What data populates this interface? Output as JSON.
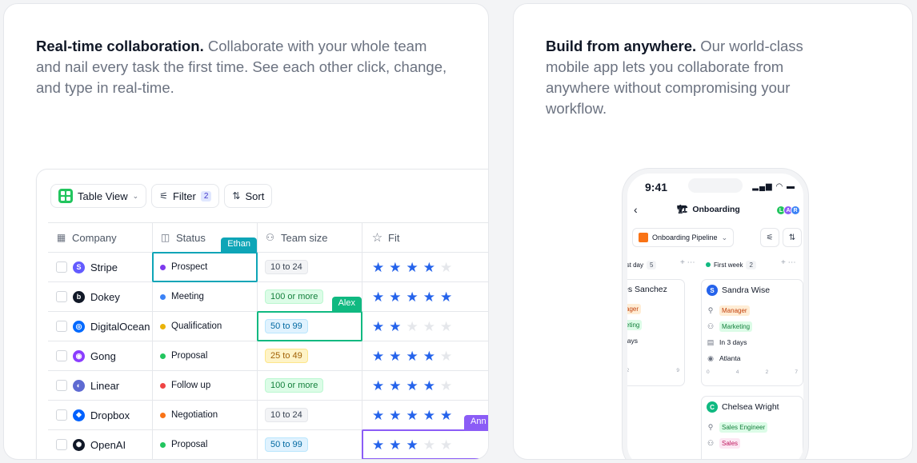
{
  "left_card": {
    "headline": "Real-time collaboration.",
    "body": " Collaborate with your whole team and nail every task the first time. See each other click, change, and type in real-time."
  },
  "right_card": {
    "headline": "Build from anywhere.",
    "body": " Our world-class mobile app lets you collaborate from anywhere without compromising your workflow."
  },
  "toolbar": {
    "table_view_label": "Table View",
    "filter_label": "Filter",
    "filter_count": "2",
    "sort_label": "Sort"
  },
  "columns": {
    "company": "Company",
    "status": "Status",
    "team_size": "Team size",
    "fit": "Fit"
  },
  "rows": [
    {
      "company": "Stripe",
      "logo_color": "#635bff",
      "logo_glyph": "S",
      "status": "Prospect",
      "status_color": "#7c3aed",
      "team": "10 to 24",
      "team_style": "gray",
      "fit": 4
    },
    {
      "company": "Dokey",
      "logo_color": "#111827",
      "logo_glyph": "b",
      "status": "Meeting",
      "status_color": "#3b82f6",
      "team": "100 or more",
      "team_style": "green",
      "fit": 5
    },
    {
      "company": "DigitalOcean",
      "logo_color": "#0069ff",
      "logo_glyph": "◎",
      "status": "Qualification",
      "status_color": "#eab308",
      "team": "50 to 99",
      "team_style": "blue",
      "fit": 2
    },
    {
      "company": "Gong",
      "logo_color": "#8b3dff",
      "logo_glyph": "◉",
      "status": "Proposal",
      "status_color": "#22c55e",
      "team": "25 to 49",
      "team_style": "yellow",
      "fit": 4
    },
    {
      "company": "Linear",
      "logo_color": "#5e6ad2",
      "logo_glyph": "◐",
      "status": "Follow up",
      "status_color": "#ef4444",
      "team": "100 or more",
      "team_style": "green",
      "fit": 4
    },
    {
      "company": "Dropbox",
      "logo_color": "#0061fe",
      "logo_glyph": "❖",
      "status": "Negotiation",
      "status_color": "#f97316",
      "team": "10 to 24",
      "team_style": "gray",
      "fit": 5
    },
    {
      "company": "OpenAI",
      "logo_color": "#111827",
      "logo_glyph": "✺",
      "status": "Proposal",
      "status_color": "#22c55e",
      "team": "50 to 99",
      "team_style": "blue",
      "fit": 3
    }
  ],
  "cursors": {
    "ethan": {
      "name": "Ethan",
      "color": "#0ea5b7"
    },
    "alex": {
      "name": "Alex",
      "color": "#10b981"
    },
    "ann": {
      "name": "Ann",
      "color": "#8b5cf6"
    }
  },
  "phone": {
    "time": "9:41",
    "status_icons": "▂▄▆ ◠ ▬",
    "back": "‹",
    "title": "Onboarding",
    "title_emoji": "🏗",
    "avatars": [
      {
        "letter": "L",
        "color": "#22c55e"
      },
      {
        "letter": "A",
        "color": "#8b5cf6"
      },
      {
        "letter": "R",
        "color": "#3b82f6"
      }
    ],
    "pipeline_label": "Onboarding Pipeline",
    "pipeline_chevron": "⌄",
    "col1": {
      "label": "rst day",
      "count": "5"
    },
    "col2": {
      "label": "First week",
      "count": "2"
    },
    "col_actions": "+ ⋯",
    "card_left": {
      "name": "es Sanchez",
      "tag1": "ager",
      "tag2": "eting",
      "line3": "days",
      "line4": "n",
      "foot_a": "12",
      "foot_b": "9"
    },
    "card_sandra": {
      "initial": "S",
      "name": "Sandra Wise",
      "tag1": "Manager",
      "tag2": "Marketing",
      "when": "In 3 days",
      "where": "Atlanta",
      "foot": [
        "0",
        "4",
        "2",
        "7"
      ]
    },
    "card_chelsea": {
      "initial": "C",
      "name": "Chelsea Wright",
      "tag1": "Sales Engineer",
      "tag2": "Sales"
    }
  }
}
